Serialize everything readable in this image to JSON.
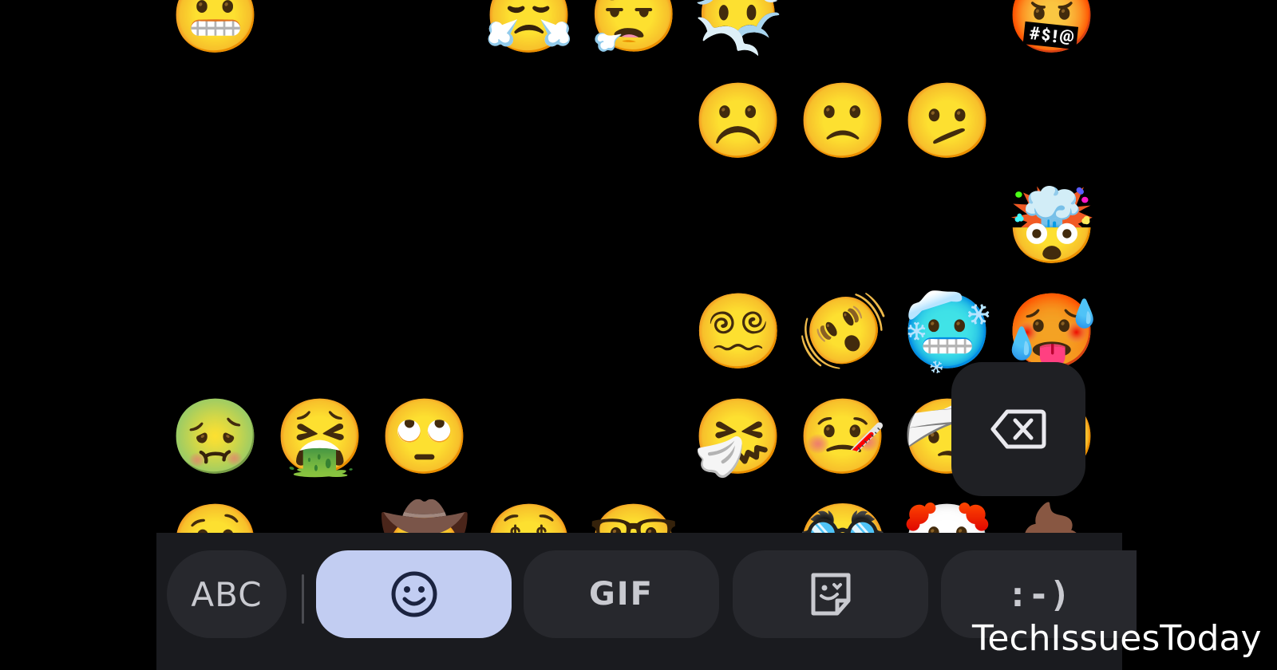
{
  "emoji_grid": {
    "rows": [
      [
        "😬",
        "😓",
        "😩",
        "😤",
        "😮‍💨",
        "😶‍🌫️",
        "😦",
        "😠",
        "🤬"
      ],
      [
        "😞",
        "😓",
        "😟",
        "😥",
        "😢",
        "☹️",
        "🙁",
        "🫤",
        "😕"
      ],
      [
        "😰",
        "😨",
        "😧",
        "😦",
        "😮",
        "😯",
        "😲",
        "😳",
        "🤯"
      ],
      [
        "😖",
        "😣",
        "😩",
        "😫",
        "😵",
        "😵‍💫",
        "🫨",
        "🥶",
        "🥵"
      ],
      [
        "🤢",
        "🤮",
        "🙄",
        "😴",
        "😪",
        "🤧",
        "🤒",
        "🤕",
        "🤑"
      ],
      [
        "🤥",
        "😇",
        "🤠",
        "🤑",
        "🤓",
        "😎",
        "🥸",
        "🤡",
        "💩"
      ]
    ]
  },
  "keyboard_bar": {
    "abc_label": "ABC",
    "emoji_icon": "smiley-face-icon",
    "gif_label": "GIF",
    "sticker_icon": "sticker-icon",
    "emoticon_label": ":-)",
    "active_tab": "emoji",
    "active_color": "#c2cdf2"
  },
  "delete_key": {
    "icon": "backspace-icon"
  },
  "watermark": {
    "text": "TechIssuesToday"
  }
}
